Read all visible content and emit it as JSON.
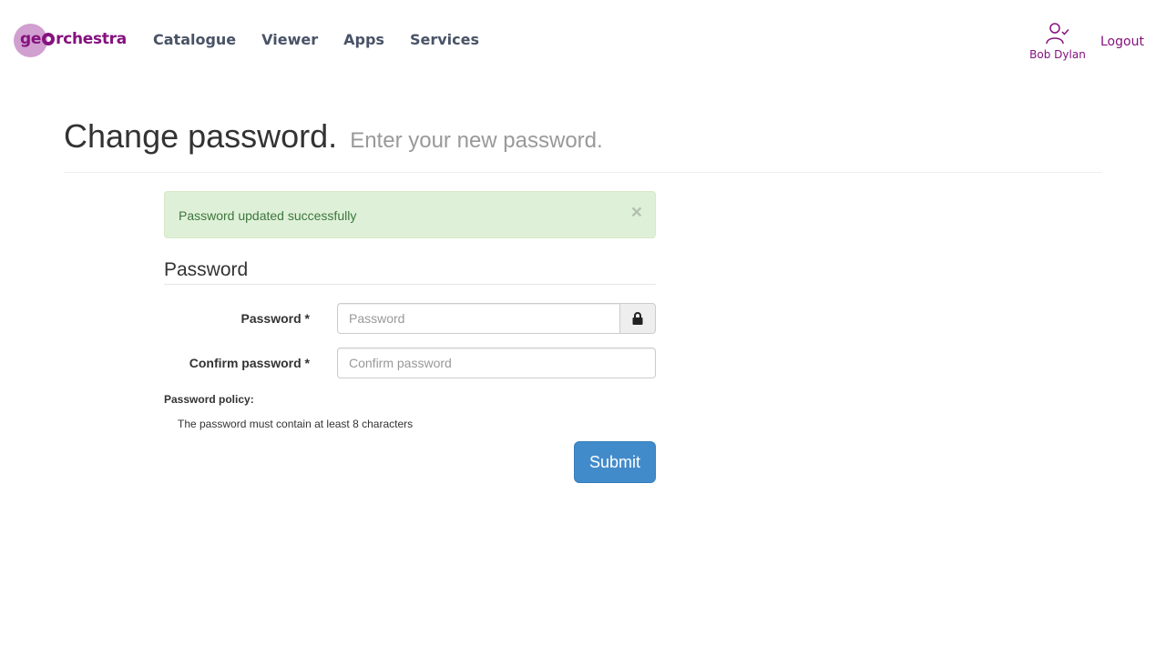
{
  "brand": {
    "logo_text_before": "ge",
    "logo_text_after": "rchestra"
  },
  "nav": {
    "items": [
      {
        "label": "Catalogue"
      },
      {
        "label": "Viewer"
      },
      {
        "label": "Apps"
      },
      {
        "label": "Services"
      }
    ]
  },
  "user": {
    "name": "Bob Dylan",
    "icon": "user-check-icon",
    "logout_label": "Logout"
  },
  "page": {
    "title": "Change password.",
    "subtitle": "Enter your new password."
  },
  "alert": {
    "message": "Password updated successfully",
    "close_label": "×"
  },
  "form": {
    "legend": "Password",
    "password": {
      "label": "Password *",
      "placeholder": "Password",
      "value": "",
      "icon": "lock-icon"
    },
    "confirm": {
      "label": "Confirm password *",
      "placeholder": "Confirm password",
      "value": ""
    },
    "policy_title": "Password policy:",
    "policy_rules": [
      "The password must contain at least 8 characters"
    ],
    "submit_label": "Submit"
  },
  "colors": {
    "brand": "#85127e",
    "brand_light": "#d19fd0",
    "nav_text": "#495366",
    "alert_bg": "#dff0d8",
    "alert_text": "#3c763d",
    "primary": "#428bca"
  }
}
